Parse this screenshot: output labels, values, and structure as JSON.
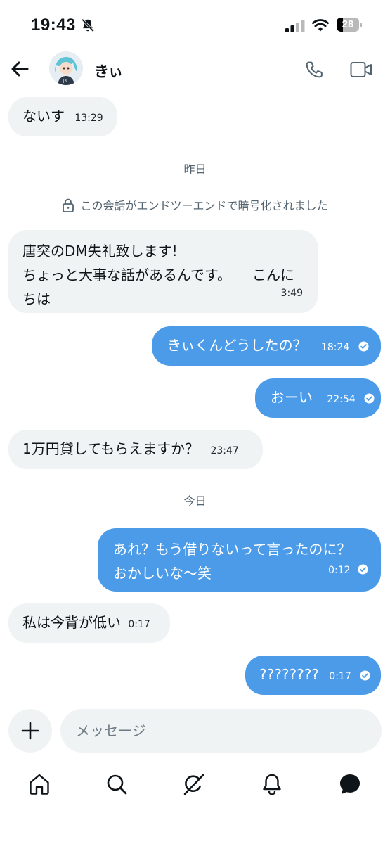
{
  "status_bar": {
    "time": "19:43",
    "battery": "28",
    "battery_level": 0.28
  },
  "header": {
    "contact_name": "きぃ"
  },
  "messages": [
    {
      "id": 0,
      "direction": "in",
      "text": "ないす",
      "time": "13:29"
    },
    {
      "id": 1,
      "direction": "in",
      "text": "唐突のDM失礼致します!\nちょっと大事な話があるんです。　　こんにちは",
      "time": "3:49"
    },
    {
      "id": 2,
      "direction": "out",
      "text": "きぃくんどうしたの？",
      "time": "18:24"
    },
    {
      "id": 3,
      "direction": "out",
      "text": "おーい",
      "time": "22:54"
    },
    {
      "id": 4,
      "direction": "in",
      "text": "1万円貸してもらえますか？",
      "time": "23:47"
    },
    {
      "id": 5,
      "direction": "out",
      "text": "あれ？もう借りないって言ったのに？\nおかしいな〜笑",
      "time": "0:12"
    },
    {
      "id": 6,
      "direction": "in",
      "text": "私は今背が低い",
      "time": "0:17"
    },
    {
      "id": 7,
      "direction": "out",
      "text": "????????",
      "time": "0:17"
    }
  ],
  "separators": {
    "yesterday": "昨日",
    "today": "今日"
  },
  "e2e_notice": "この会話がエンドツーエンドで暗号化されました",
  "composer": {
    "placeholder": "メッセージ"
  },
  "colors": {
    "outgoing": "#4c9be8",
    "incoming": "#eff3f4",
    "meta": "#536471"
  },
  "icons": {
    "back": "arrow-left-icon",
    "call": "phone-icon",
    "video": "video-camera-icon",
    "e2e": "lock-icon",
    "add": "plus-icon",
    "read": "check-circle-icon",
    "nav": [
      "home-icon",
      "search-icon",
      "grok-icon",
      "notifications-icon",
      "messages-icon"
    ]
  }
}
